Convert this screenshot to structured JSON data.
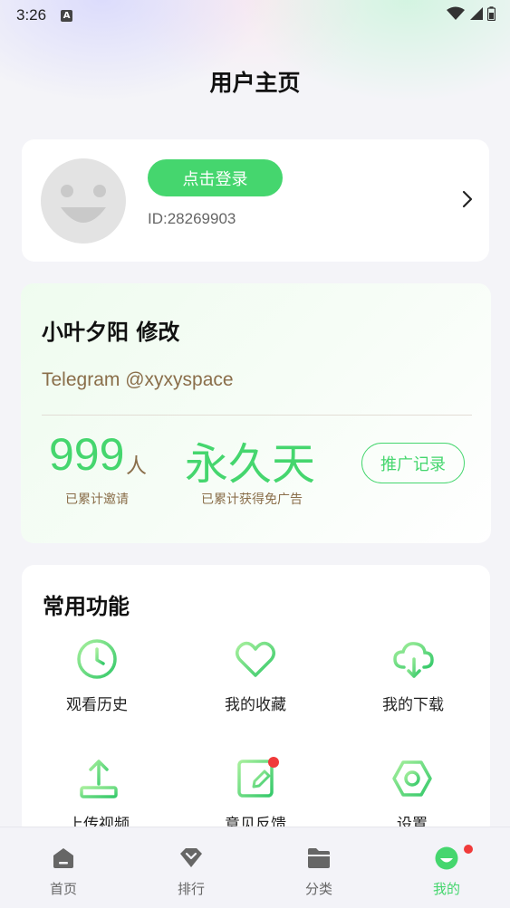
{
  "status_bar": {
    "time": "3:26",
    "notification_glyph": "A"
  },
  "header": {
    "title": "用户主页"
  },
  "login": {
    "button_label": "点击登录",
    "user_id": "ID:28269903"
  },
  "promo": {
    "title": "小叶夕阳 修改",
    "subtitle": "Telegram @xyxyspace",
    "invite_count": "999",
    "invite_unit": "人",
    "invite_label": "已累计邀请",
    "ad_free_value": "永久天",
    "ad_free_label": "已累计获得免广告",
    "record_button": "推广记录"
  },
  "functions": {
    "title": "常用功能",
    "items": [
      {
        "label": "观看历史",
        "icon": "clock-icon"
      },
      {
        "label": "我的收藏",
        "icon": "heart-icon"
      },
      {
        "label": "我的下载",
        "icon": "cloud-download-icon"
      },
      {
        "label": "上传视频",
        "icon": "upload-icon"
      },
      {
        "label": "意见反馈",
        "icon": "feedback-icon",
        "badge": true
      },
      {
        "label": "设置",
        "icon": "settings-icon"
      }
    ]
  },
  "tab_bar": {
    "items": [
      {
        "label": "首页",
        "icon": "home-icon"
      },
      {
        "label": "排行",
        "icon": "ranking-icon"
      },
      {
        "label": "分类",
        "icon": "folder-icon"
      },
      {
        "label": "我的",
        "icon": "profile-icon",
        "active": true,
        "badge": true
      }
    ]
  },
  "colors": {
    "accent": "#45d66e",
    "promo_text": "#8a6e4a",
    "badge": "#f03a3a"
  }
}
